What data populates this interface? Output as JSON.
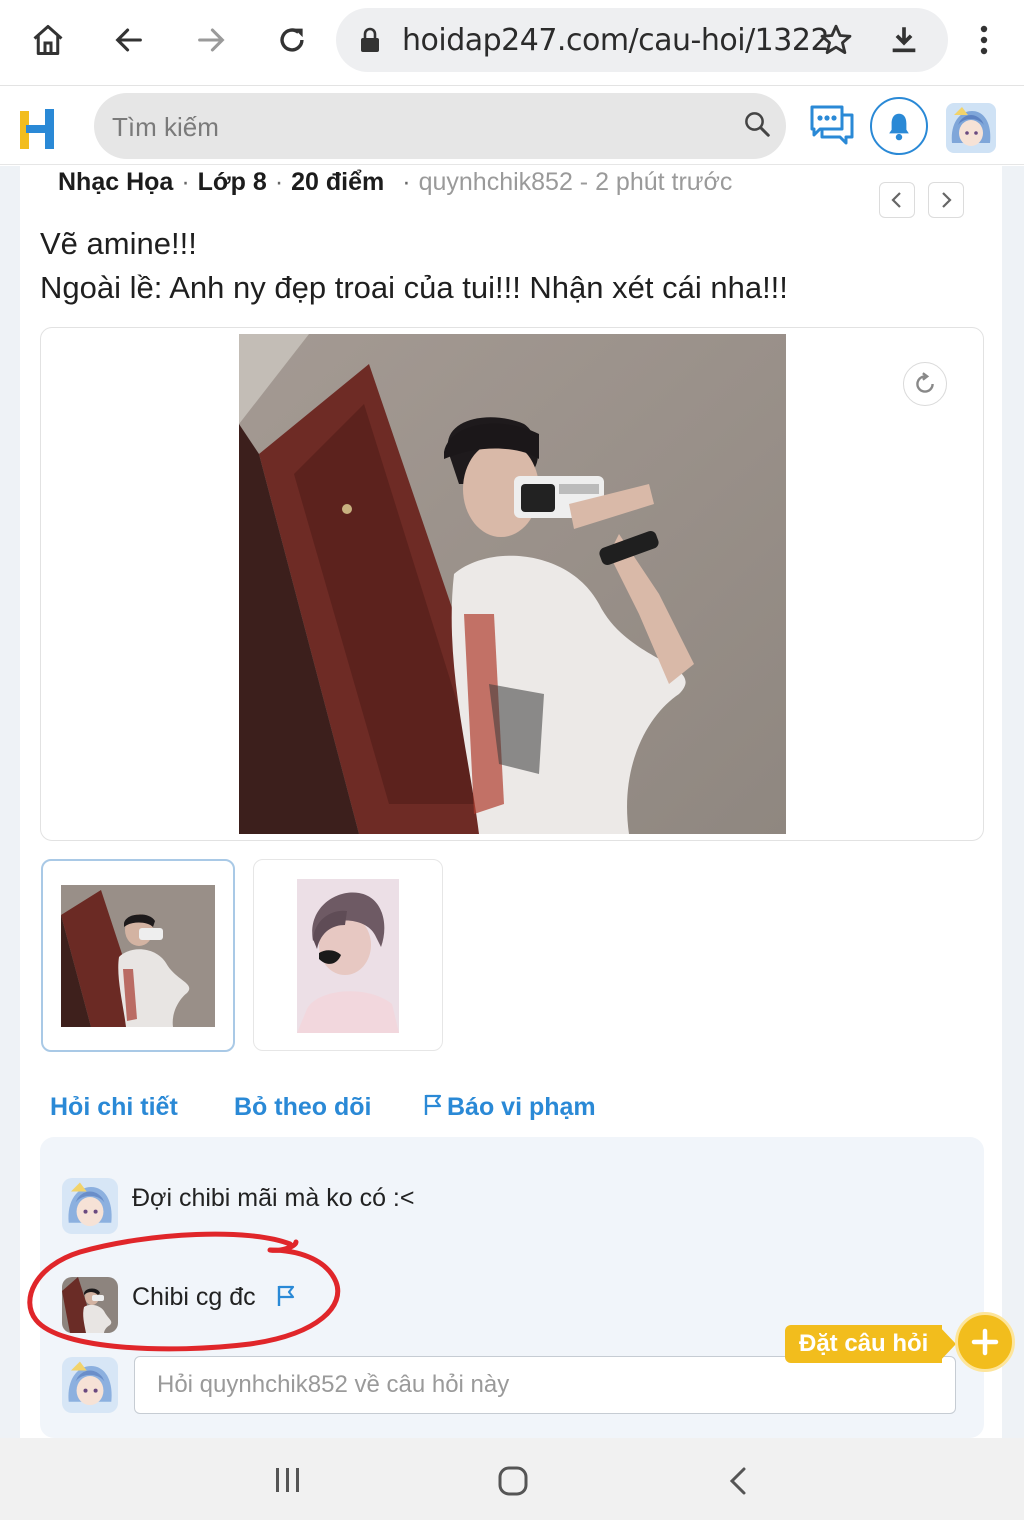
{
  "browser": {
    "url": "hoidap247.com/cau-hoi/1322",
    "icons": [
      "home-icon",
      "back-icon",
      "forward-icon",
      "reload-icon",
      "lock-icon",
      "star-icon",
      "download-icon",
      "more-vert-icon"
    ]
  },
  "header": {
    "logo": "H",
    "search_placeholder": "Tìm kiếm",
    "icons": [
      "search-icon",
      "chat-icon",
      "bell-icon",
      "user-avatar"
    ]
  },
  "question": {
    "subject": "Nhạc Họa",
    "grade": "Lớp 8",
    "points": "20 điểm",
    "author_time": "quynhchik852 - 2 phút trước",
    "title_line1": "Vẽ amine!!!",
    "title_line2": "Ngoài lề: Anh ny đẹp troai của tui!!! Nhận xét cái nha!!!",
    "thumbnail_count": 2
  },
  "actions": {
    "ask_detail": "Hỏi chi tiết",
    "unfollow": "Bỏ theo dõi",
    "report": "Báo vi phạm"
  },
  "comments": [
    {
      "text": "Đợi chibi mãi mà ko có :<"
    },
    {
      "text": "Chibi cg đc"
    }
  ],
  "ask_input_placeholder": "Hỏi quynhchik852 về câu hỏi này",
  "fab_label": "Đặt câu hỏi",
  "colors": {
    "accent_blue": "#2a89d6",
    "accent_yellow": "#f2bd1d",
    "annotation_red": "#e0262a"
  }
}
